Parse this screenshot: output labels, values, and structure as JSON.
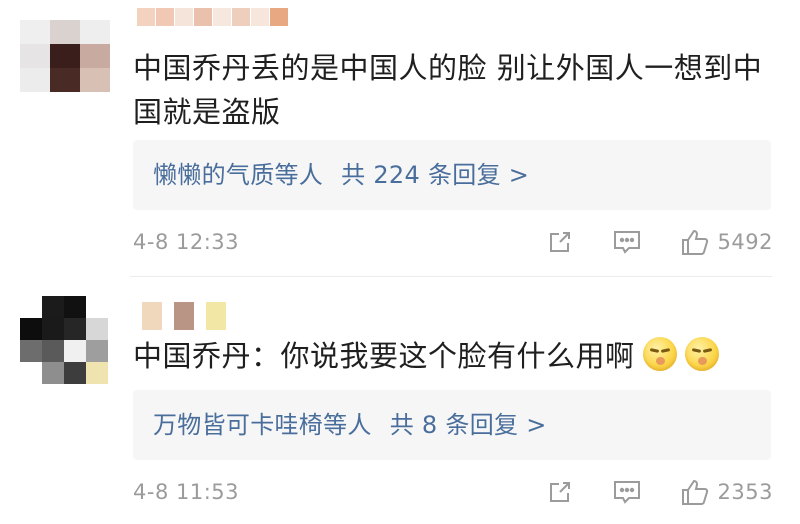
{
  "comments": [
    {
      "text": "中国乔丹丢的是中国人的脸 别让外国人一想到中国就是盗版",
      "reply_names": "懒懒的气质等人",
      "reply_count": "共 224 条回复 >",
      "time": "4-8 12:33",
      "likes": "5492"
    },
    {
      "text": "中国乔丹：你说我要这个脸有什么用啊",
      "reply_names": "万物皆可卡哇椅等人",
      "reply_count": "共 8 条回复 >",
      "time": "4-8 11:53",
      "likes": "2353"
    }
  ],
  "icons": {
    "share": "share-icon",
    "comment": "comment-icon",
    "like": "thumbs-up-icon",
    "emoji": "shush-face-emoji"
  },
  "colors": {
    "reply_link": "#4a6e9c",
    "meta_gray": "#9b9b9b",
    "reply_bg": "#f6f6f6"
  }
}
